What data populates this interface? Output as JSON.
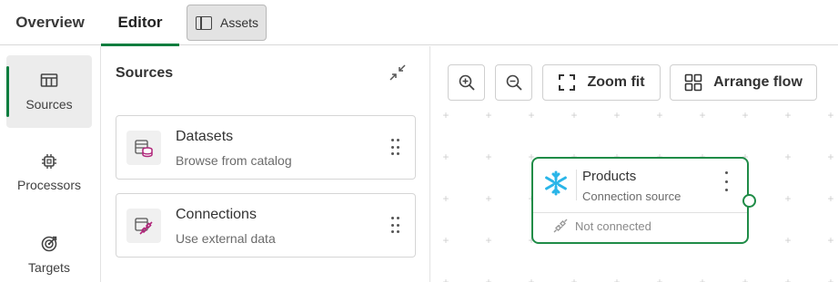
{
  "tabs": {
    "overview": "Overview",
    "editor": "Editor",
    "assets": "Assets"
  },
  "rail": {
    "items": [
      {
        "label": "Sources",
        "icon": "sources-icon",
        "active": true
      },
      {
        "label": "Processors",
        "icon": "chip-icon",
        "active": false
      },
      {
        "label": "Targets",
        "icon": "target-icon",
        "active": false
      }
    ]
  },
  "panel": {
    "title": "Sources",
    "cards": [
      {
        "title": "Datasets",
        "subtitle": "Browse from catalog",
        "icon": "database-icon"
      },
      {
        "title": "Connections",
        "subtitle": "Use external data",
        "icon": "connection-icon"
      }
    ]
  },
  "toolbar": {
    "zoom_fit": "Zoom fit",
    "arrange_flow": "Arrange flow"
  },
  "node": {
    "title": "Products",
    "subtitle": "Connection source",
    "status": "Not connected",
    "icon": "snowflake-icon"
  },
  "colors": {
    "accent": "#1f8c47",
    "snowflake": "#29b5e8",
    "dataset_icon": "#b0267a"
  }
}
